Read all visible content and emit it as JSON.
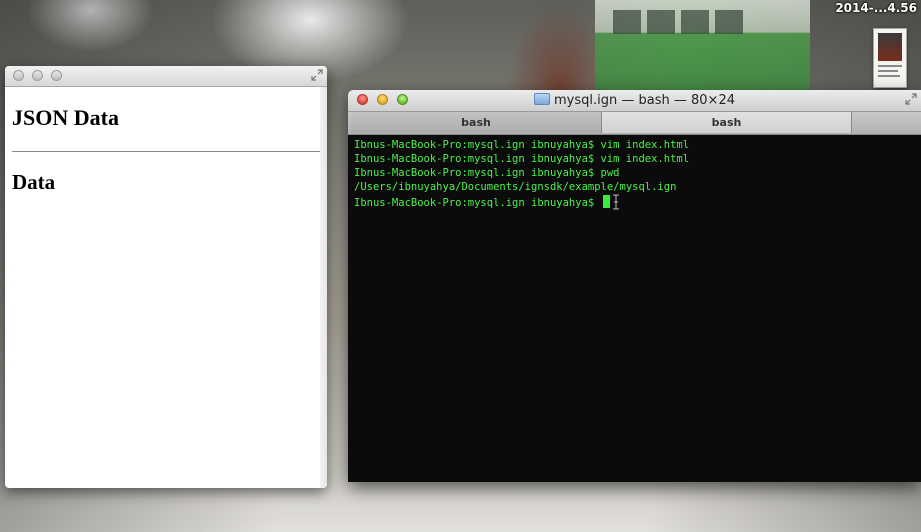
{
  "desktop": {
    "clock": "2014-...4.56"
  },
  "browser_window": {
    "heading": "JSON Data",
    "subheading": "Data"
  },
  "terminal": {
    "title": "mysql.ign — bash — 80×24",
    "tabs": [
      "bash",
      "bash"
    ],
    "lines": [
      "Ibnus-MacBook-Pro:mysql.ign ibnuyahya$ vim index.html",
      "Ibnus-MacBook-Pro:mysql.ign ibnuyahya$ vim index.html",
      "Ibnus-MacBook-Pro:mysql.ign ibnuyahya$ pwd",
      "/Users/ibnuyahya/Documents/ignsdk/example/mysql.ign",
      "Ibnus-MacBook-Pro:mysql.ign ibnuyahya$ "
    ],
    "text_color": "#4cf04c",
    "background_color": "#0b0b0b"
  }
}
